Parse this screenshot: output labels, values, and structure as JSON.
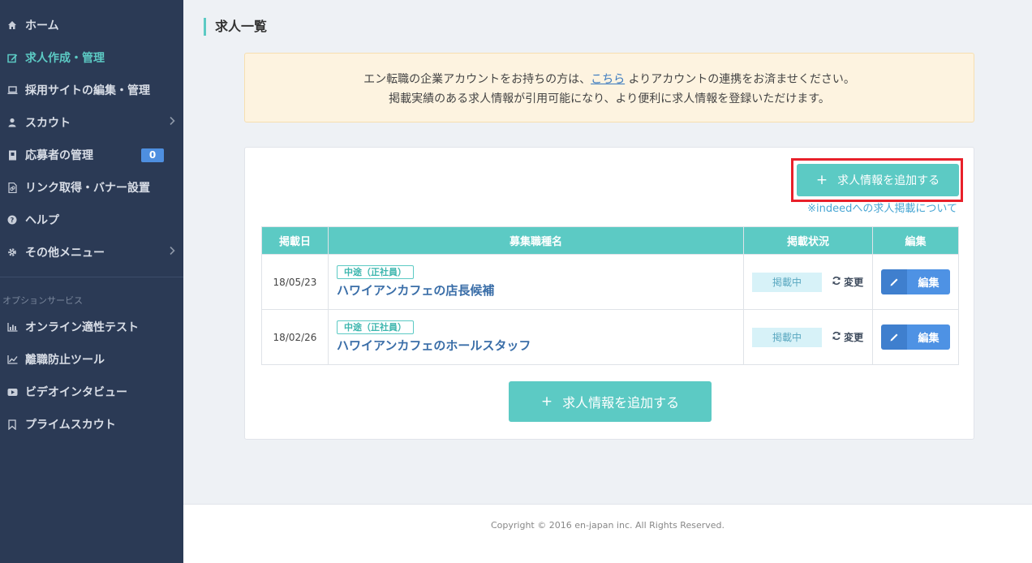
{
  "sidebar": {
    "items": [
      {
        "label": "ホーム",
        "icon": "home-icon"
      },
      {
        "label": "求人作成・管理",
        "icon": "edit-icon",
        "active": true
      },
      {
        "label": "採用サイトの編集・管理",
        "icon": "laptop-icon"
      },
      {
        "label": "スカウト",
        "icon": "user-icon",
        "has_submenu": true
      },
      {
        "label": "応募者の管理",
        "icon": "id-card-icon",
        "badge": "0"
      },
      {
        "label": "リンク取得・バナー設置",
        "icon": "link-icon"
      },
      {
        "label": "ヘルプ",
        "icon": "question-icon"
      },
      {
        "label": "その他メニュー",
        "icon": "gear-icon",
        "has_submenu": true
      }
    ],
    "options_label": "オプションサービス",
    "option_items": [
      {
        "label": "オンライン適性テスト",
        "icon": "bar-chart-icon"
      },
      {
        "label": "離職防止ツール",
        "icon": "line-chart-icon"
      },
      {
        "label": "ビデオインタビュー",
        "icon": "video-icon"
      },
      {
        "label": "プライムスカウト",
        "icon": "bookmark-icon"
      }
    ]
  },
  "page": {
    "title": "求人一覧"
  },
  "notice": {
    "line1_pre": "エン転職の企業アカウントをお持ちの方は、",
    "link": "こちら",
    "line1_post": " よりアカウントの連携をお済ませください。",
    "line2": "掲載実績のある求人情報が引用可能になり、より便利に求人情報を登録いただけます。"
  },
  "actions": {
    "add_job": "求人情報を追加する",
    "indeed_link": "※indeedへの求人掲載について"
  },
  "table": {
    "headers": [
      "掲載日",
      "募集職種名",
      "掲載状況",
      "編集"
    ],
    "rows": [
      {
        "date": "18/05/23",
        "type": "中途（正社員）",
        "title": "ハワイアンカフェの店長候補",
        "status": "掲載中",
        "change": "変更",
        "edit": "編集"
      },
      {
        "date": "18/02/26",
        "type": "中途（正社員）",
        "title": "ハワイアンカフェのホールスタッフ",
        "status": "掲載中",
        "change": "変更",
        "edit": "編集"
      }
    ]
  },
  "footer": {
    "copyright": "Copyright © 2016 en-japan inc. All Rights Reserved."
  },
  "colors": {
    "sidebar_bg": "#2b3a55",
    "accent": "#5ccac4",
    "edit_button": "#4e92e4",
    "highlight_border": "#e8202a"
  }
}
